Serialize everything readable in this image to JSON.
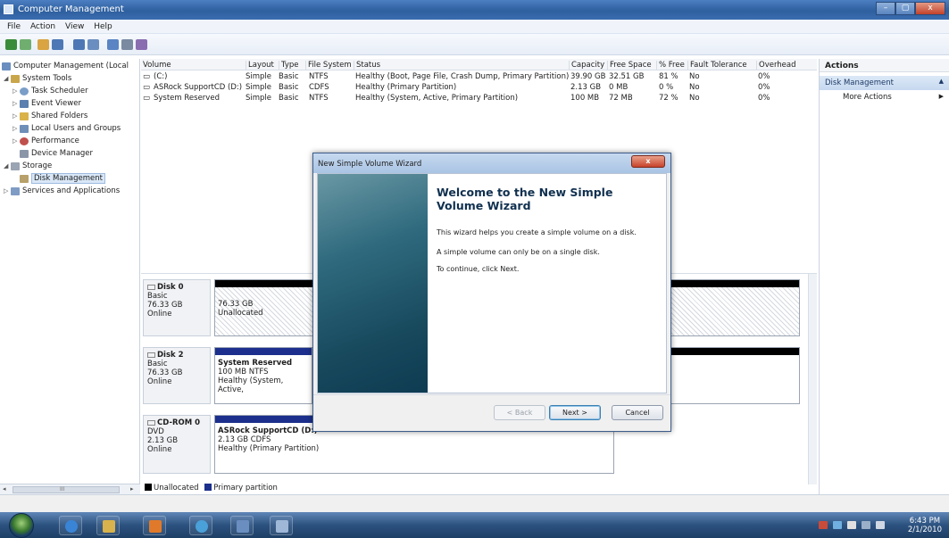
{
  "window": {
    "title": "Computer Management",
    "controls": [
      "–",
      "▢",
      "x"
    ]
  },
  "menu": [
    "File",
    "Action",
    "View",
    "Help"
  ],
  "nav": {
    "items": [
      {
        "label": "Computer Management (Local",
        "level": 0,
        "exp": ""
      },
      {
        "label": "System Tools",
        "level": 1,
        "exp": "◢"
      },
      {
        "label": "Task Scheduler",
        "level": 2,
        "exp": "▷"
      },
      {
        "label": "Event Viewer",
        "level": 2,
        "exp": "▷"
      },
      {
        "label": "Shared Folders",
        "level": 2,
        "exp": "▷"
      },
      {
        "label": "Local Users and Groups",
        "level": 2,
        "exp": "▷"
      },
      {
        "label": "Performance",
        "level": 2,
        "exp": "▷"
      },
      {
        "label": "Device Manager",
        "level": 2,
        "exp": ""
      },
      {
        "label": "Storage",
        "level": 1,
        "exp": "◢"
      },
      {
        "label": "Disk Management",
        "level": 2,
        "exp": ""
      },
      {
        "label": "Services and Applications",
        "level": 1,
        "exp": "▷"
      }
    ],
    "scroll_left": "◂",
    "scroll_mid": "III",
    "scroll_right": "▸"
  },
  "volumes": {
    "columns": [
      "Volume",
      "Layout",
      "Type",
      "File System",
      "Status",
      "Capacity",
      "Free Space",
      "% Free",
      "Fault Tolerance",
      "Overhead"
    ],
    "rows": [
      [
        "(C:)",
        "Simple",
        "Basic",
        "NTFS",
        "Healthy (Boot, Page File, Crash Dump, Primary Partition)",
        "39.90 GB",
        "32.51 GB",
        "81 %",
        "No",
        "0%"
      ],
      [
        "ASRock SupportCD (D:)",
        "Simple",
        "Basic",
        "CDFS",
        "Healthy (Primary Partition)",
        "2.13 GB",
        "0 MB",
        "0 %",
        "No",
        "0%"
      ],
      [
        "System Reserved",
        "Simple",
        "Basic",
        "NTFS",
        "Healthy (System, Active, Primary Partition)",
        "100 MB",
        "72 MB",
        "72 %",
        "No",
        "0%"
      ]
    ]
  },
  "disks": [
    {
      "name": "Disk 0",
      "type": "Basic",
      "size": "76.33 GB",
      "state": "Online",
      "part_size": "76.33 GB",
      "part_status": "Unallocated"
    },
    {
      "name": "Disk 2",
      "type": "Basic",
      "size": "76.33 GB",
      "state": "Online",
      "part_name": "System Reserved",
      "part_size": "100 MB NTFS",
      "part_status": "Healthy (System, Active,"
    },
    {
      "name": "CD-ROM 0",
      "type": "DVD",
      "size": "2.13 GB",
      "state": "Online",
      "part_name": "ASRock SupportCD  (D:)",
      "part_size": "2.13 GB CDFS",
      "part_status": "Healthy (Primary Partition)"
    }
  ],
  "legend": {
    "unallocated": "Unallocated",
    "primary": "Primary partition"
  },
  "actions": {
    "header": "Actions",
    "section": "Disk Management",
    "item": "More Actions"
  },
  "wizard": {
    "title": "New Simple Volume Wizard",
    "close": "x",
    "heading_line1": "Welcome to the New Simple",
    "heading_line2": "Volume Wizard",
    "p1": "This wizard helps you create a simple volume on a disk.",
    "p2": "A simple volume can only be on a single disk.",
    "p3": "To continue, click Next.",
    "back": "< Back",
    "next": "Next >",
    "cancel": "Cancel"
  },
  "clock": {
    "time": "6:43 PM",
    "date": "2/1/2010"
  },
  "colors": {
    "primary_partition": "#1c2f8c",
    "unallocated": "#000000",
    "accent": "#2e5f9e"
  }
}
